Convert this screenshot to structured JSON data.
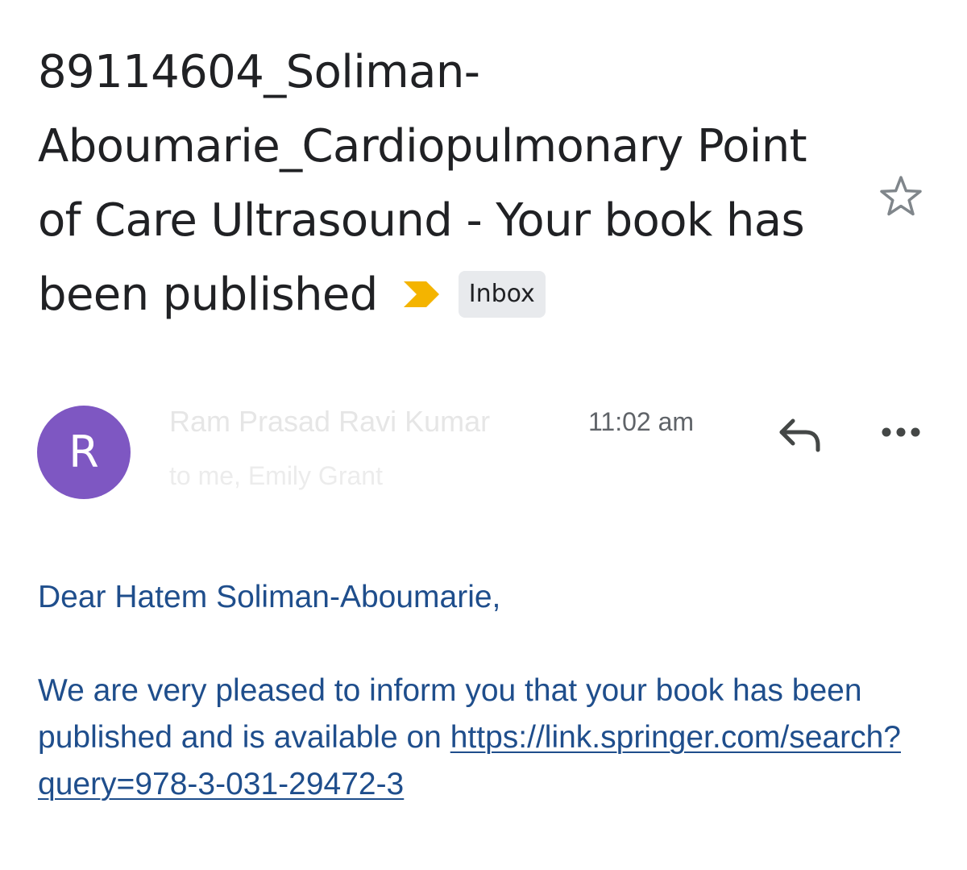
{
  "subject": {
    "text": "89114604_Soliman-Aboumarie_Cardiopulmonary Point of Care Ultrasound - Your book has been published",
    "label": "Inbox",
    "importance_icon": "importance-marker-icon",
    "star_icon": "star-icon"
  },
  "message": {
    "avatar_letter": "R",
    "avatar_color": "#7e57c2",
    "sender": "Ram Prasad Ravi Kumar",
    "time": "11:02 am",
    "recipients": "to me, Emily Grant",
    "reply_icon": "reply-icon",
    "more_icon": "more-options-icon"
  },
  "body": {
    "greeting": "Dear Hatem Soliman-Aboumarie,",
    "paragraph_text": "We are very pleased to inform you that your book has been published and is available on ",
    "link": "https://link.springer.com/search?query=978-3-031-29472-3"
  },
  "colors": {
    "body_text": "#1f4e8c",
    "importance": "#f4b400",
    "label_bg": "#e8eaed"
  }
}
